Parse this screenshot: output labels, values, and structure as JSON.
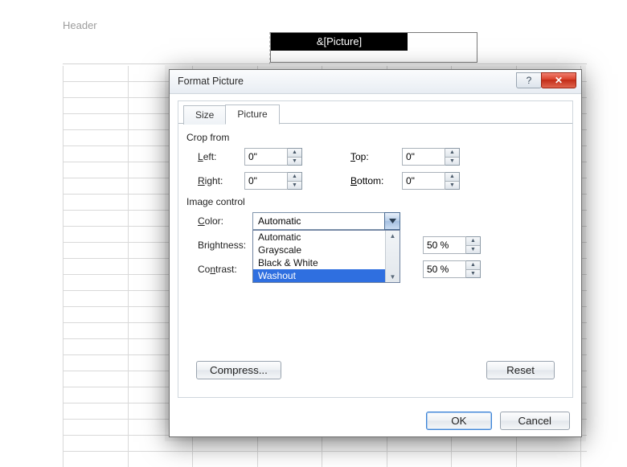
{
  "sheet": {
    "header_label": "Header",
    "header_cell_text": "&[Picture]"
  },
  "dialog": {
    "title": "Format Picture",
    "help_glyph": "?",
    "close_glyph": "✕",
    "tabs": {
      "size": "Size",
      "picture": "Picture"
    },
    "crop": {
      "section": "Crop from",
      "left_label": "Left:",
      "right_label": "Right:",
      "top_label": "Top:",
      "bottom_label": "Bottom:",
      "left_value": "0\"",
      "right_value": "0\"",
      "top_value": "0\"",
      "bottom_value": "0\""
    },
    "image": {
      "section": "Image control",
      "color_label": "Color:",
      "color_value": "Automatic",
      "color_options": [
        "Automatic",
        "Grayscale",
        "Black & White",
        "Washout"
      ],
      "color_selected_index": 3,
      "brightness_label": "Brightness:",
      "brightness_value": "50 %",
      "contrast_label": "Contrast:",
      "contrast_value": "50 %"
    },
    "buttons": {
      "compress": "Compress...",
      "reset": "Reset",
      "ok": "OK",
      "cancel": "Cancel"
    }
  }
}
